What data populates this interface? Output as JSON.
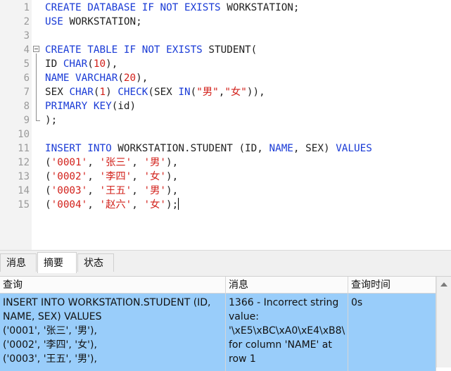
{
  "editor": {
    "lines": [
      {
        "n": "1",
        "tokens": [
          {
            "t": "CREATE DATABASE IF NOT EXISTS ",
            "c": "kw"
          },
          {
            "t": "WORKSTATION;",
            "c": ""
          }
        ]
      },
      {
        "n": "2",
        "tokens": [
          {
            "t": "USE ",
            "c": "kw"
          },
          {
            "t": "WORKSTATION;",
            "c": ""
          }
        ]
      },
      {
        "n": "3",
        "tokens": []
      },
      {
        "n": "4",
        "tokens": [
          {
            "t": "CREATE TABLE IF NOT EXISTS ",
            "c": "kw"
          },
          {
            "t": "STUDENT(",
            "c": ""
          }
        ]
      },
      {
        "n": "5",
        "tokens": [
          {
            "t": "ID ",
            "c": ""
          },
          {
            "t": "CHAR",
            "c": "kw"
          },
          {
            "t": "(",
            "c": ""
          },
          {
            "t": "10",
            "c": "num"
          },
          {
            "t": "),",
            "c": ""
          }
        ]
      },
      {
        "n": "6",
        "tokens": [
          {
            "t": "NAME ",
            "c": "kw"
          },
          {
            "t": "VARCHAR",
            "c": "kw"
          },
          {
            "t": "(",
            "c": ""
          },
          {
            "t": "20",
            "c": "num"
          },
          {
            "t": "),",
            "c": ""
          }
        ]
      },
      {
        "n": "7",
        "tokens": [
          {
            "t": "SEX ",
            "c": ""
          },
          {
            "t": "CHAR",
            "c": "kw"
          },
          {
            "t": "(",
            "c": ""
          },
          {
            "t": "1",
            "c": "num"
          },
          {
            "t": ") ",
            "c": ""
          },
          {
            "t": "CHECK",
            "c": "kw"
          },
          {
            "t": "(SEX ",
            "c": ""
          },
          {
            "t": "IN",
            "c": "kw"
          },
          {
            "t": "(",
            "c": ""
          },
          {
            "t": "\"男\"",
            "c": "str"
          },
          {
            "t": ",",
            "c": ""
          },
          {
            "t": "\"女\"",
            "c": "str"
          },
          {
            "t": ")),",
            "c": ""
          }
        ]
      },
      {
        "n": "8",
        "tokens": [
          {
            "t": "PRIMARY KEY",
            "c": "kw"
          },
          {
            "t": "(id)",
            "c": ""
          }
        ]
      },
      {
        "n": "9",
        "tokens": [
          {
            "t": ");",
            "c": ""
          }
        ]
      },
      {
        "n": "10",
        "tokens": []
      },
      {
        "n": "11",
        "tokens": [
          {
            "t": "INSERT INTO ",
            "c": "kw"
          },
          {
            "t": "WORKSTATION.STUDENT (ID, ",
            "c": ""
          },
          {
            "t": "NAME",
            "c": "kw"
          },
          {
            "t": ", SEX) ",
            "c": ""
          },
          {
            "t": "VALUES",
            "c": "kw"
          }
        ]
      },
      {
        "n": "12",
        "tokens": [
          {
            "t": "(",
            "c": ""
          },
          {
            "t": "'0001'",
            "c": "str"
          },
          {
            "t": ", ",
            "c": ""
          },
          {
            "t": "'张三'",
            "c": "str"
          },
          {
            "t": ", ",
            "c": ""
          },
          {
            "t": "'男'",
            "c": "str"
          },
          {
            "t": "),",
            "c": ""
          }
        ]
      },
      {
        "n": "13",
        "tokens": [
          {
            "t": "(",
            "c": ""
          },
          {
            "t": "'0002'",
            "c": "str"
          },
          {
            "t": ", ",
            "c": ""
          },
          {
            "t": "'李四'",
            "c": "str"
          },
          {
            "t": ", ",
            "c": ""
          },
          {
            "t": "'女'",
            "c": "str"
          },
          {
            "t": "),",
            "c": ""
          }
        ]
      },
      {
        "n": "14",
        "tokens": [
          {
            "t": "(",
            "c": ""
          },
          {
            "t": "'0003'",
            "c": "str"
          },
          {
            "t": ", ",
            "c": ""
          },
          {
            "t": "'王五'",
            "c": "str"
          },
          {
            "t": ", ",
            "c": ""
          },
          {
            "t": "'男'",
            "c": "str"
          },
          {
            "t": "),",
            "c": ""
          }
        ]
      },
      {
        "n": "15",
        "tokens": [
          {
            "t": "(",
            "c": ""
          },
          {
            "t": "'0004'",
            "c": "str"
          },
          {
            "t": ", ",
            "c": ""
          },
          {
            "t": "'赵六'",
            "c": "str"
          },
          {
            "t": ", ",
            "c": ""
          },
          {
            "t": "'女'",
            "c": "str"
          },
          {
            "t": ");",
            "c": ""
          }
        ]
      }
    ]
  },
  "tabs": [
    {
      "label": "消息",
      "active": false
    },
    {
      "label": "摘要",
      "active": true
    },
    {
      "label": "状态",
      "active": false
    }
  ],
  "grid": {
    "headers": [
      "查询",
      "消息",
      "查询时间"
    ],
    "row": {
      "query": "INSERT INTO WORKSTATION.STUDENT (ID,\nNAME, SEX) VALUES\n('0001', '张三', '男'),\n('0002', '李四', '女'),\n('0003', '王五', '男'),",
      "message": "1366 - Incorrect string\nvalue:\n'\\xE5\\xBC\\xA0\\xE4\\xB8\\\nfor column 'NAME' at\nrow 1",
      "time": "0s"
    }
  },
  "colors": {
    "keyword": "#1a3bd6",
    "string": "#d2201a",
    "selection": "#99cdfa"
  }
}
